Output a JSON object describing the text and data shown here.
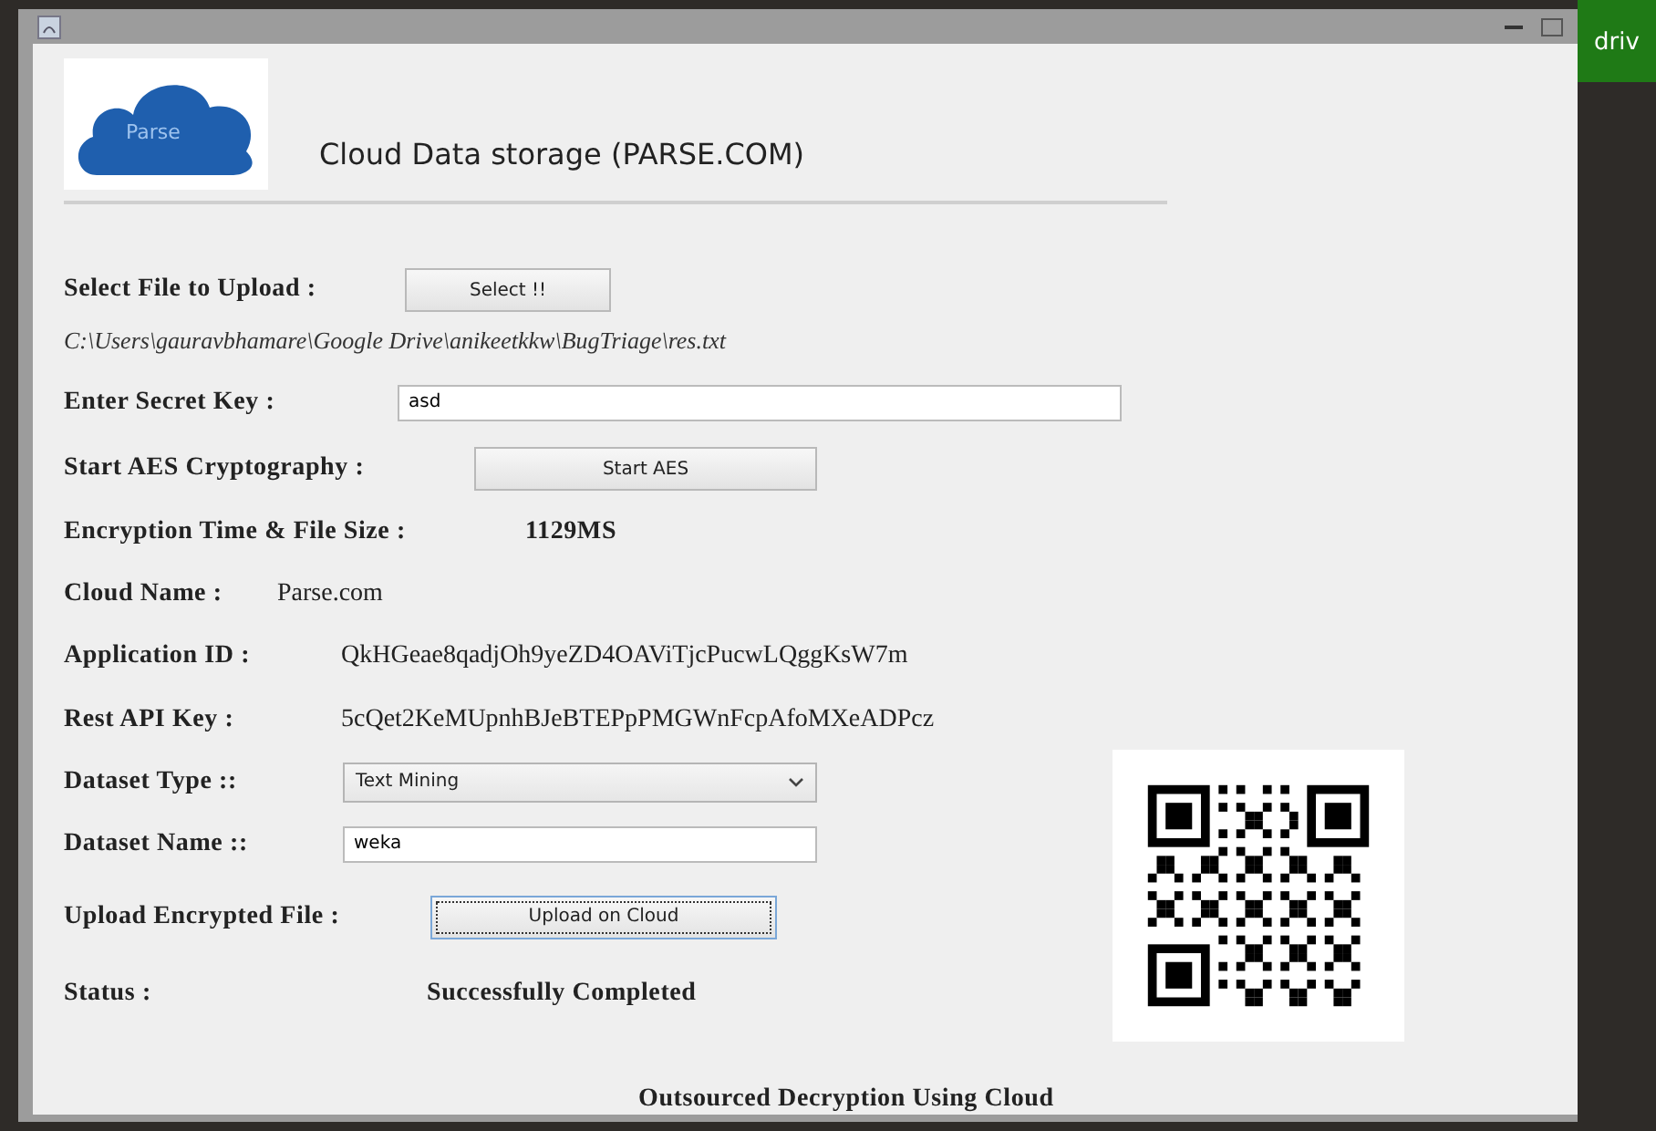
{
  "header": {
    "logo_text": "Parse",
    "title": "Cloud Data storage (PARSE.COM)"
  },
  "form": [
    {
      "kind": "button",
      "label": "Select File to Upload :",
      "button": "Select !!",
      "focused": false
    },
    {
      "kind": "path",
      "text": "C:\\Users\\gauravbhamare\\Google Drive\\anikeetkkw\\BugTriage\\res.txt"
    },
    {
      "kind": "field",
      "label": "Enter Secret Key :",
      "value": "asd"
    },
    {
      "kind": "button",
      "label": "Start AES Cryptography :",
      "button": "Start AES",
      "focused": false
    },
    {
      "kind": "value",
      "label": "Encryption Time & File Size :",
      "value": "1129MS",
      "bold": true
    },
    {
      "kind": "value",
      "label": "Cloud Name :",
      "value": "Parse.com",
      "bold": false
    },
    {
      "kind": "value",
      "label": "Application ID :",
      "value": "QkHGeae8qadjOh9yeZD4OAViTjcPucwLQggKsW7m",
      "bold": false
    },
    {
      "kind": "value",
      "label": "Rest API Key :",
      "value": "5cQet2KeMUpnhBJeBTEPpPMGWnFcpAfoMXeADPcz",
      "bold": false
    },
    {
      "kind": "select",
      "label": "Dataset Type ::",
      "value": "Text Mining"
    },
    {
      "kind": "field",
      "label": "Dataset Name ::",
      "value": "weka"
    },
    {
      "kind": "button",
      "label": "Upload Encrypted File :",
      "button": "Upload on Cloud",
      "focused": true
    },
    {
      "kind": "value",
      "label": "Status :",
      "value": "Successfully Completed",
      "bold": true
    }
  ],
  "footer": "Outsourced Decryption Using Cloud",
  "side_tile": {
    "text": "driv"
  }
}
